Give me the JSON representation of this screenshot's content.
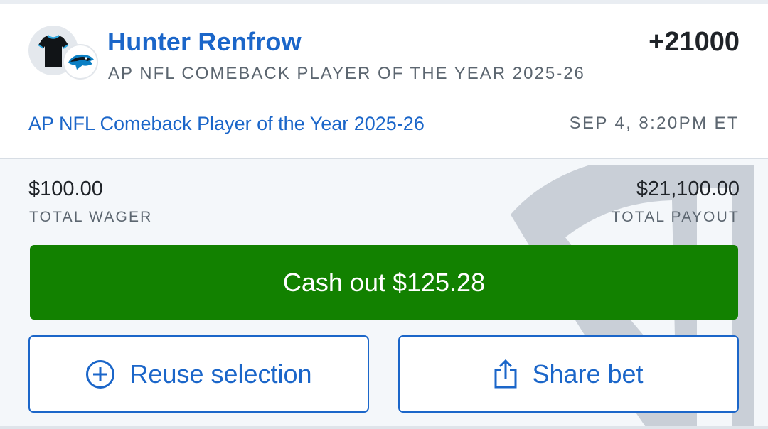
{
  "bet": {
    "player_name": "Hunter Renfrow",
    "odds": "+21000",
    "market": "AP NFL COMEBACK PLAYER OF THE YEAR 2025-26",
    "event_name": "AP NFL Comeback Player of the Year 2025-26",
    "event_time": "SEP 4, 8:20PM ET",
    "avatar_icon": "jersey-icon",
    "team_icon": "panther-logo-icon"
  },
  "totals": {
    "wager_amount": "$100.00",
    "wager_label": "TOTAL WAGER",
    "payout_amount": "$21,100.00",
    "payout_label": "TOTAL PAYOUT"
  },
  "actions": {
    "cashout_label": "Cash out $125.28",
    "reuse_label": "Reuse selection",
    "reuse_icon": "plus-circle-icon",
    "share_label": "Share bet",
    "share_icon": "share-icon"
  },
  "colors": {
    "link_blue": "#1b66c9",
    "cashout_green": "#128100",
    "muted_text": "#5c6670"
  }
}
